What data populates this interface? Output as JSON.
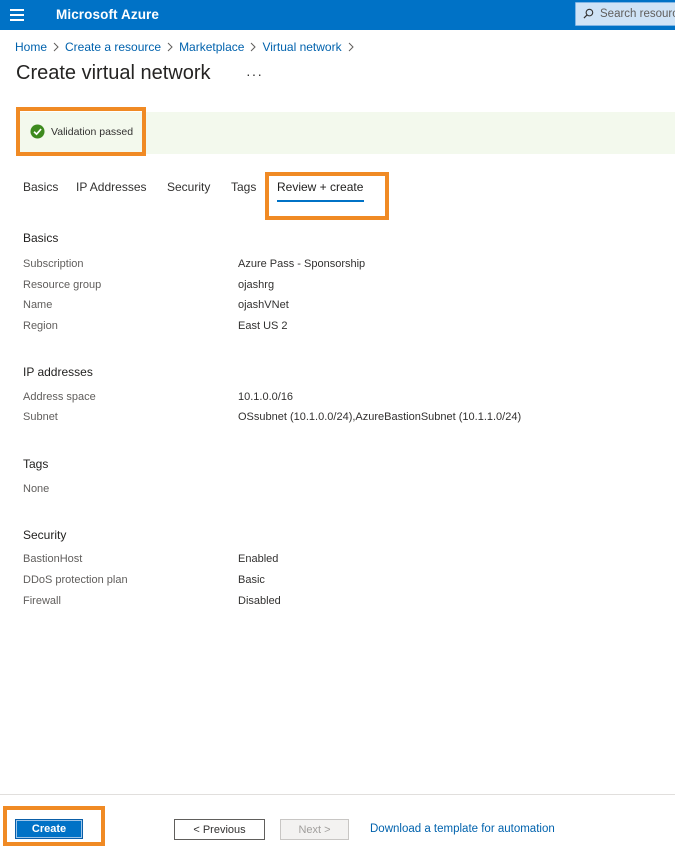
{
  "header": {
    "brand": "Microsoft Azure",
    "search_placeholder": "Search resources"
  },
  "breadcrumb": [
    "Home",
    "Create a resource",
    "Marketplace",
    "Virtual network"
  ],
  "page": {
    "title": "Create virtual network",
    "more": "···"
  },
  "validation": {
    "text": "Validation passed",
    "color": "#3d8a1e"
  },
  "tabs": [
    "Basics",
    "IP Addresses",
    "Security",
    "Tags",
    "Review + create"
  ],
  "active_tab": "Review + create",
  "sections": {
    "basics": {
      "title": "Basics",
      "rows": [
        {
          "label": "Subscription",
          "value": "Azure Pass - Sponsorship"
        },
        {
          "label": "Resource group",
          "value": "ojashrg"
        },
        {
          "label": "Name",
          "value": "ojashVNet"
        },
        {
          "label": "Region",
          "value": "East US 2"
        }
      ]
    },
    "ip": {
      "title": "IP addresses",
      "rows": [
        {
          "label": "Address space",
          "value": "10.1.0.0/16"
        },
        {
          "label": "Subnet",
          "value": "OSsubnet (10.1.0.0/24),AzureBastionSubnet (10.1.1.0/24)"
        }
      ]
    },
    "tags": {
      "title": "Tags",
      "none": "None"
    },
    "security": {
      "title": "Security",
      "rows": [
        {
          "label": "BastionHost",
          "value": "Enabled"
        },
        {
          "label": "DDoS protection plan",
          "value": "Basic"
        },
        {
          "label": "Firewall",
          "value": "Disabled"
        }
      ]
    }
  },
  "footer": {
    "create": "Create",
    "previous": "< Previous",
    "next": "Next >",
    "download": "Download a template for automation"
  },
  "colors": {
    "accent": "#0072c6",
    "highlight": "#f08a24",
    "link": "#0062ad"
  }
}
